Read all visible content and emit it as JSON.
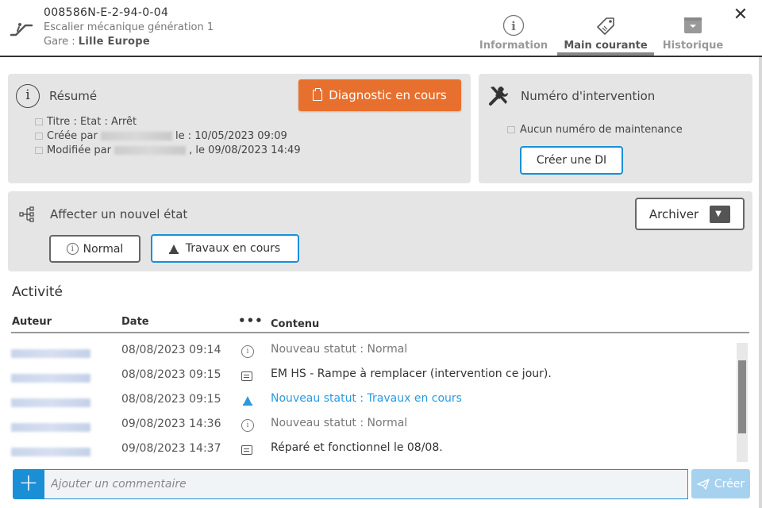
{
  "header": {
    "equipment_id": "008586N-E-2-94-0-04",
    "equipment_type": "Escalier mécanique génération 1",
    "station_prefix": "Gare : ",
    "station_name": "Lille Europe",
    "equipment_icon": "escalator-icon",
    "close_label": "✕"
  },
  "tabs": [
    {
      "label": "Information",
      "icon": "info-circle-icon",
      "active": false
    },
    {
      "label": "Main courante",
      "icon": "tag-icon",
      "active": true
    },
    {
      "label": "Historique",
      "icon": "archive-icon",
      "active": false
    }
  ],
  "resume": {
    "title": "Résumé",
    "icon": "info-circle-icon",
    "status_button": "Diagnostic en cours",
    "status_button_color": "#e8702e",
    "title_line": "Titre : Etat : Arrêt",
    "created_prefix": "Créée par",
    "created_suffix": "le : 10/05/2023 09:09",
    "modified_prefix": "Modifiée par",
    "modified_suffix": ", le 09/08/2023 14:49"
  },
  "numero": {
    "title": "Numéro d'intervention",
    "icon": "tools-icon",
    "no_maintenance": "Aucun numéro de maintenance",
    "create_button": "Créer une DI"
  },
  "etat": {
    "title": "Affecter un nouvel état",
    "icon": "hierarchy-icon",
    "archive_button": "Archiver",
    "normal_button": "Normal",
    "travaux_button": "Travaux en cours"
  },
  "activity": {
    "title": "Activité",
    "columns": {
      "author": "Auteur",
      "date": "Date",
      "dots": "•••",
      "content": "Contenu"
    },
    "rows": [
      {
        "date": "08/08/2023 09:14",
        "icon": "info-icon",
        "content": "Nouveau statut : Normal",
        "style": "muted"
      },
      {
        "date": "08/08/2023 09:15",
        "icon": "message-icon",
        "content": "EM HS - Rampe à remplacer (intervention ce jour).",
        "style": "normal"
      },
      {
        "date": "08/08/2023 09:15",
        "icon": "cone-icon",
        "content": "Nouveau statut : Travaux en cours",
        "style": "blue"
      },
      {
        "date": "09/08/2023 14:36",
        "icon": "info-icon",
        "content": "Nouveau statut : Normal",
        "style": "muted"
      },
      {
        "date": "09/08/2023 14:37",
        "icon": "message-icon",
        "content": "Réparé et fonctionnel le 08/08.",
        "style": "normal"
      }
    ]
  },
  "comment": {
    "add_label": "+",
    "placeholder": "Ajouter un commentaire",
    "send_label": "Créer"
  },
  "colors": {
    "accent": "#1a8fd6",
    "diagnostic": "#e8702e",
    "status_blue": "#2a9ae0"
  }
}
